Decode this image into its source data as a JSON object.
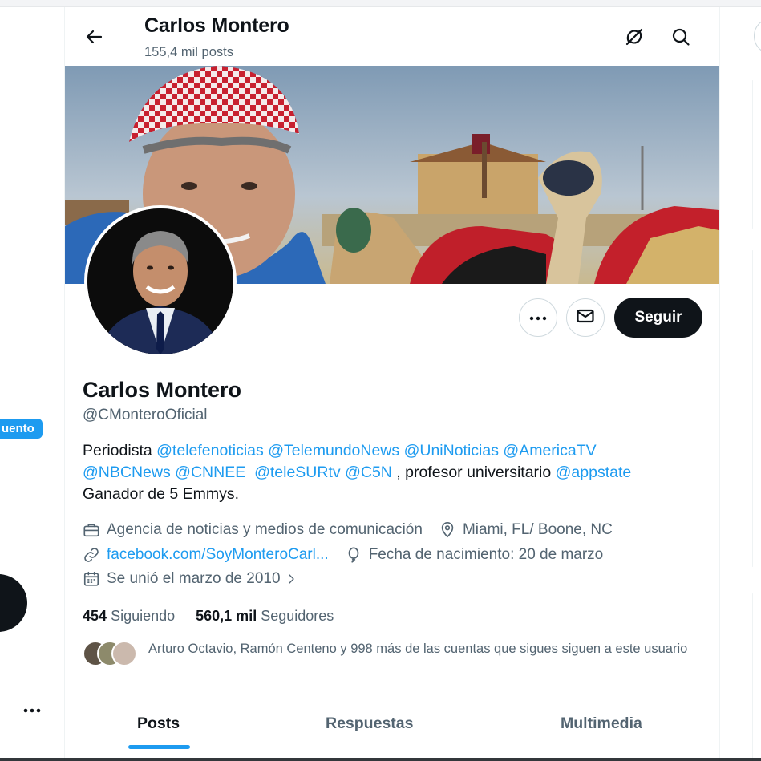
{
  "header": {
    "name": "Carlos Montero",
    "posts_count": "155,4 mil posts"
  },
  "profile": {
    "name": "Carlos Montero",
    "handle": "@CMonteroOficial",
    "bio": {
      "line1": [
        {
          "text": "Periodista ",
          "link": false
        },
        {
          "text": "@telefenoticias",
          "link": true
        },
        {
          "text": " ",
          "link": false
        },
        {
          "text": "@TelemundoNews",
          "link": true
        },
        {
          "text": " ",
          "link": false
        },
        {
          "text": "@UniNoticias",
          "link": true
        },
        {
          "text": " ",
          "link": false
        },
        {
          "text": "@AmericaTV",
          "link": true
        }
      ],
      "line2": [
        {
          "text": "@NBCNews",
          "link": true
        },
        {
          "text": " ",
          "link": false
        },
        {
          "text": "@CNNEE",
          "link": true
        },
        {
          "text": "  ",
          "link": false
        },
        {
          "text": "@teleSURtv",
          "link": true
        },
        {
          "text": " ",
          "link": false
        },
        {
          "text": "@C5N",
          "link": true
        },
        {
          "text": " , profesor universitario ",
          "link": false
        },
        {
          "text": "@appstate",
          "link": true
        }
      ],
      "line3": "Ganador de 5 Emmys."
    },
    "category": "Agencia de noticias y medios de comunicación",
    "location": "Miami, FL/ Boone, NC",
    "website": "facebook.com/SoyMonteroCarl...",
    "birthday": "Fecha de nacimiento: 20 de marzo",
    "joined": "Se unió el marzo de 2010",
    "following_count": "454",
    "following_label": "Siguiendo",
    "followers_count": "560,1 mil",
    "followers_label": "Seguidores",
    "mutual_text": "Arturo Octavio, Ramón Centeno y 998 más de las cuentas que sigues siguen a este usuario"
  },
  "actions": {
    "follow_label": "Seguir"
  },
  "tabs": [
    {
      "label": "Posts",
      "active": true
    },
    {
      "label": "Respuestas",
      "active": false
    },
    {
      "label": "Multimedia",
      "active": false
    }
  ],
  "sidebar": {
    "badge_label": "uento"
  },
  "icons": [
    "back-arrow-icon",
    "grok-icon",
    "search-icon",
    "more-icon",
    "mail-icon",
    "briefcase-icon",
    "location-pin-icon",
    "link-icon",
    "balloon-icon",
    "calendar-icon",
    "chevron-right-icon"
  ],
  "colors": {
    "accent": "#1d9bf0",
    "text": "#0f1419",
    "secondary": "#536471",
    "border": "#cfd9de"
  }
}
